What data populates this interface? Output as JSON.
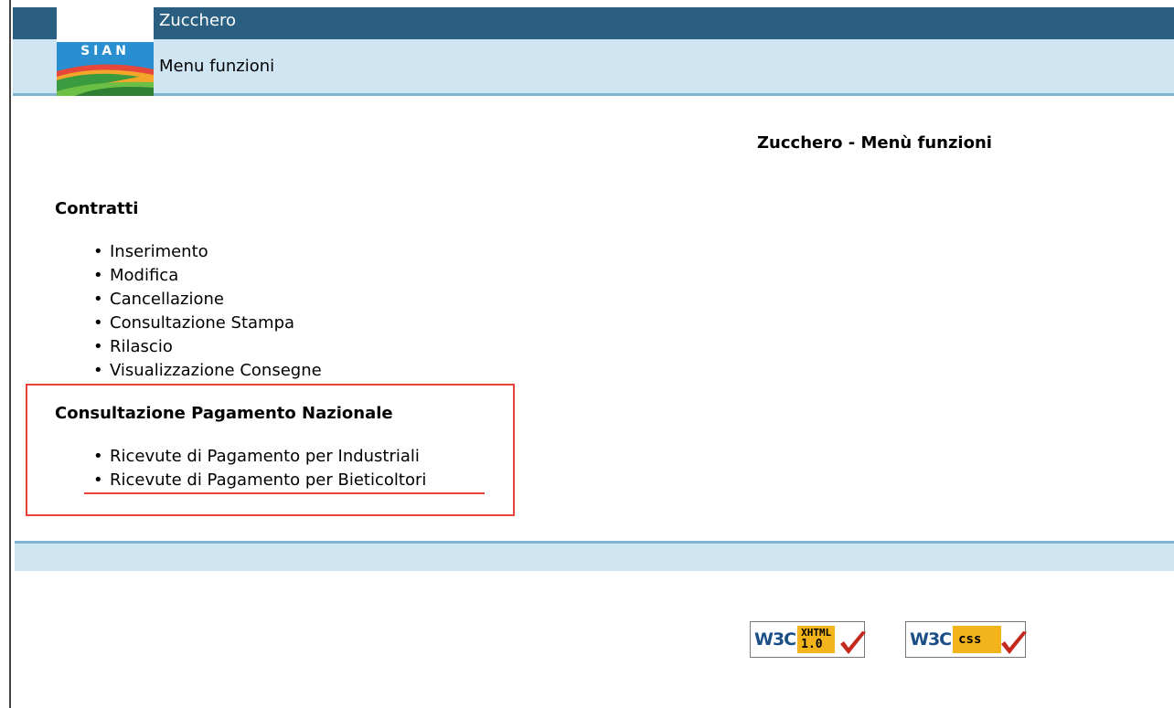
{
  "header": {
    "title": "Zucchero",
    "subtitle": "Menu funzioni",
    "logo_text": "SIAN"
  },
  "page_title": "Zucchero - Menù funzioni",
  "sections": [
    {
      "title": "Contratti",
      "items": [
        "Inserimento",
        "Modifica",
        "Cancellazione",
        "Consultazione Stampa",
        "Rilascio",
        "Visualizzazione Consegne"
      ]
    },
    {
      "title": "Consultazione Pagamento Nazionale",
      "items": [
        "Ricevute di Pagamento per Industriali",
        "Ricevute di Pagamento per Bieticoltori"
      ]
    }
  ],
  "badges": {
    "xhtml": {
      "org": "W3C",
      "line1": "XHTML",
      "line2": "1.0"
    },
    "css": {
      "org": "W3C",
      "line1": "css"
    }
  },
  "colors": {
    "header_bg": "#2a5f82",
    "subheader_bg": "#cfe5f2",
    "accent_border": "#7fb2d3",
    "highlight_red": "#e8413c",
    "logo_blue": "#2a8fd0"
  }
}
